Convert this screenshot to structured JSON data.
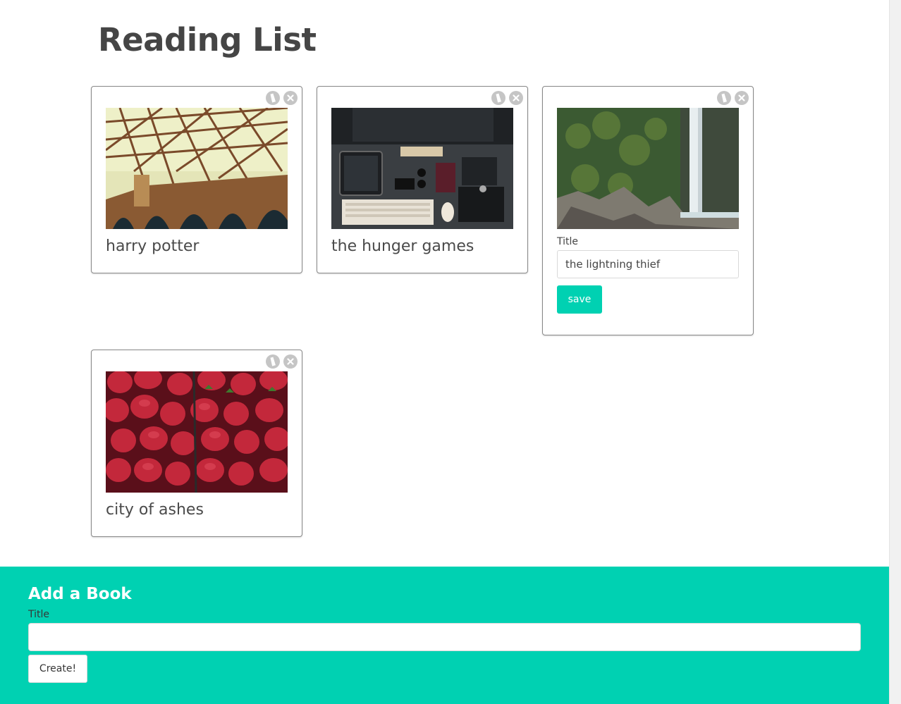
{
  "page": {
    "title": "Reading List"
  },
  "books": [
    {
      "title": "harry potter",
      "image": "bridge-steel-arches-image",
      "edit_icon": "edit-icon",
      "delete_icon": "delete-icon"
    },
    {
      "title": "the hunger games",
      "image": "desk-flatlay-image",
      "edit_icon": "edit-icon",
      "delete_icon": "delete-icon"
    },
    {
      "title": "the lightning thief",
      "image": "waterfall-image",
      "editing": true,
      "edit_label": "Title",
      "edit_value": "the lightning thief",
      "save_label": "save"
    },
    {
      "title": "city of ashes",
      "image": "strawberries-image",
      "edit_icon": "edit-icon",
      "delete_icon": "delete-icon"
    }
  ],
  "add_book": {
    "heading": "Add a Book",
    "title_label": "Title",
    "title_value": "",
    "create_label": "Create!"
  },
  "colors": {
    "accent": "#00d1b2",
    "text": "#454545",
    "icon": "#c5c5c5"
  }
}
